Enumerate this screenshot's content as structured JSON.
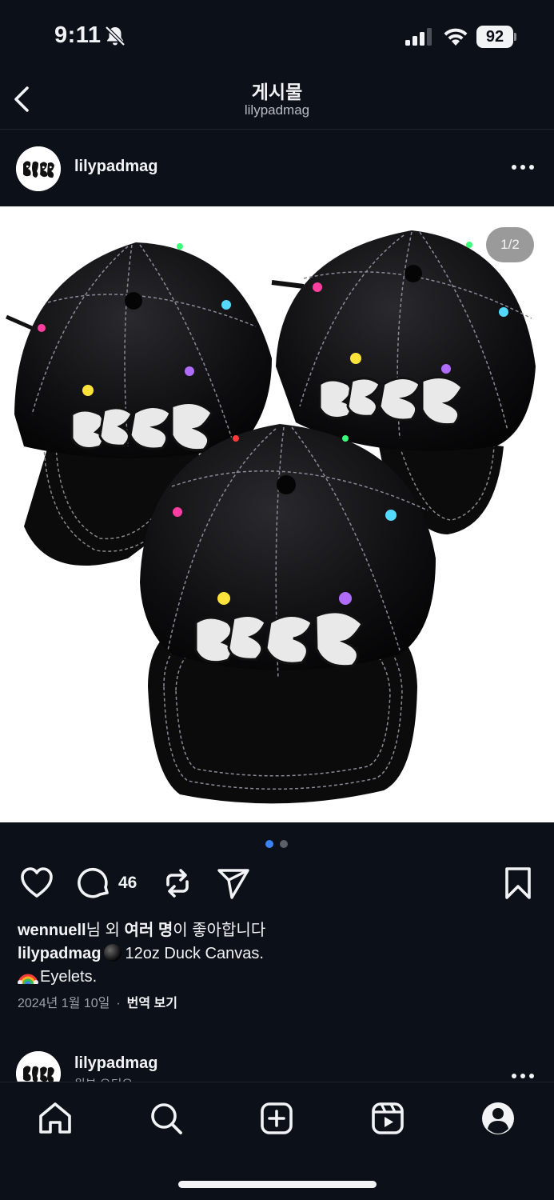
{
  "status_bar": {
    "time": "9:11",
    "battery": "92"
  },
  "header": {
    "title": "게시물",
    "subtitle": "lilypadmag"
  },
  "post": {
    "username": "lilypadmag",
    "image_counter": "1/2",
    "comment_count": "46",
    "likes": {
      "user": "wennuell",
      "mid": "님 외 ",
      "bold": "여러 명",
      "suffix": "이 좋아합니다"
    },
    "caption": {
      "user": "lilypadmag",
      "line1": "12oz Duck Canvas.",
      "line2": "Eyelets."
    },
    "date": "2024년 1월 10일",
    "separator": "·",
    "translate_label": "번역 보기"
  },
  "next_post": {
    "username": "lilypadmag",
    "subtitle": "원본 오디오"
  },
  "colors": {
    "background": "#0c1019",
    "text": "#f2f3f5",
    "muted": "#9ba0a8",
    "dot_active": "#3b82f6",
    "dot_inactive": "#5b6068"
  },
  "icons": {
    "status": [
      "bell-slash-icon",
      "signal-icon",
      "wifi-icon",
      "battery-icon"
    ],
    "nav": [
      "back-chevron-icon"
    ],
    "actions": [
      "heart-icon",
      "comment-icon",
      "repost-icon",
      "send-icon",
      "bookmark-icon"
    ],
    "tabs": [
      "home-icon",
      "search-icon",
      "create-icon",
      "reels-icon",
      "profile-icon"
    ]
  }
}
